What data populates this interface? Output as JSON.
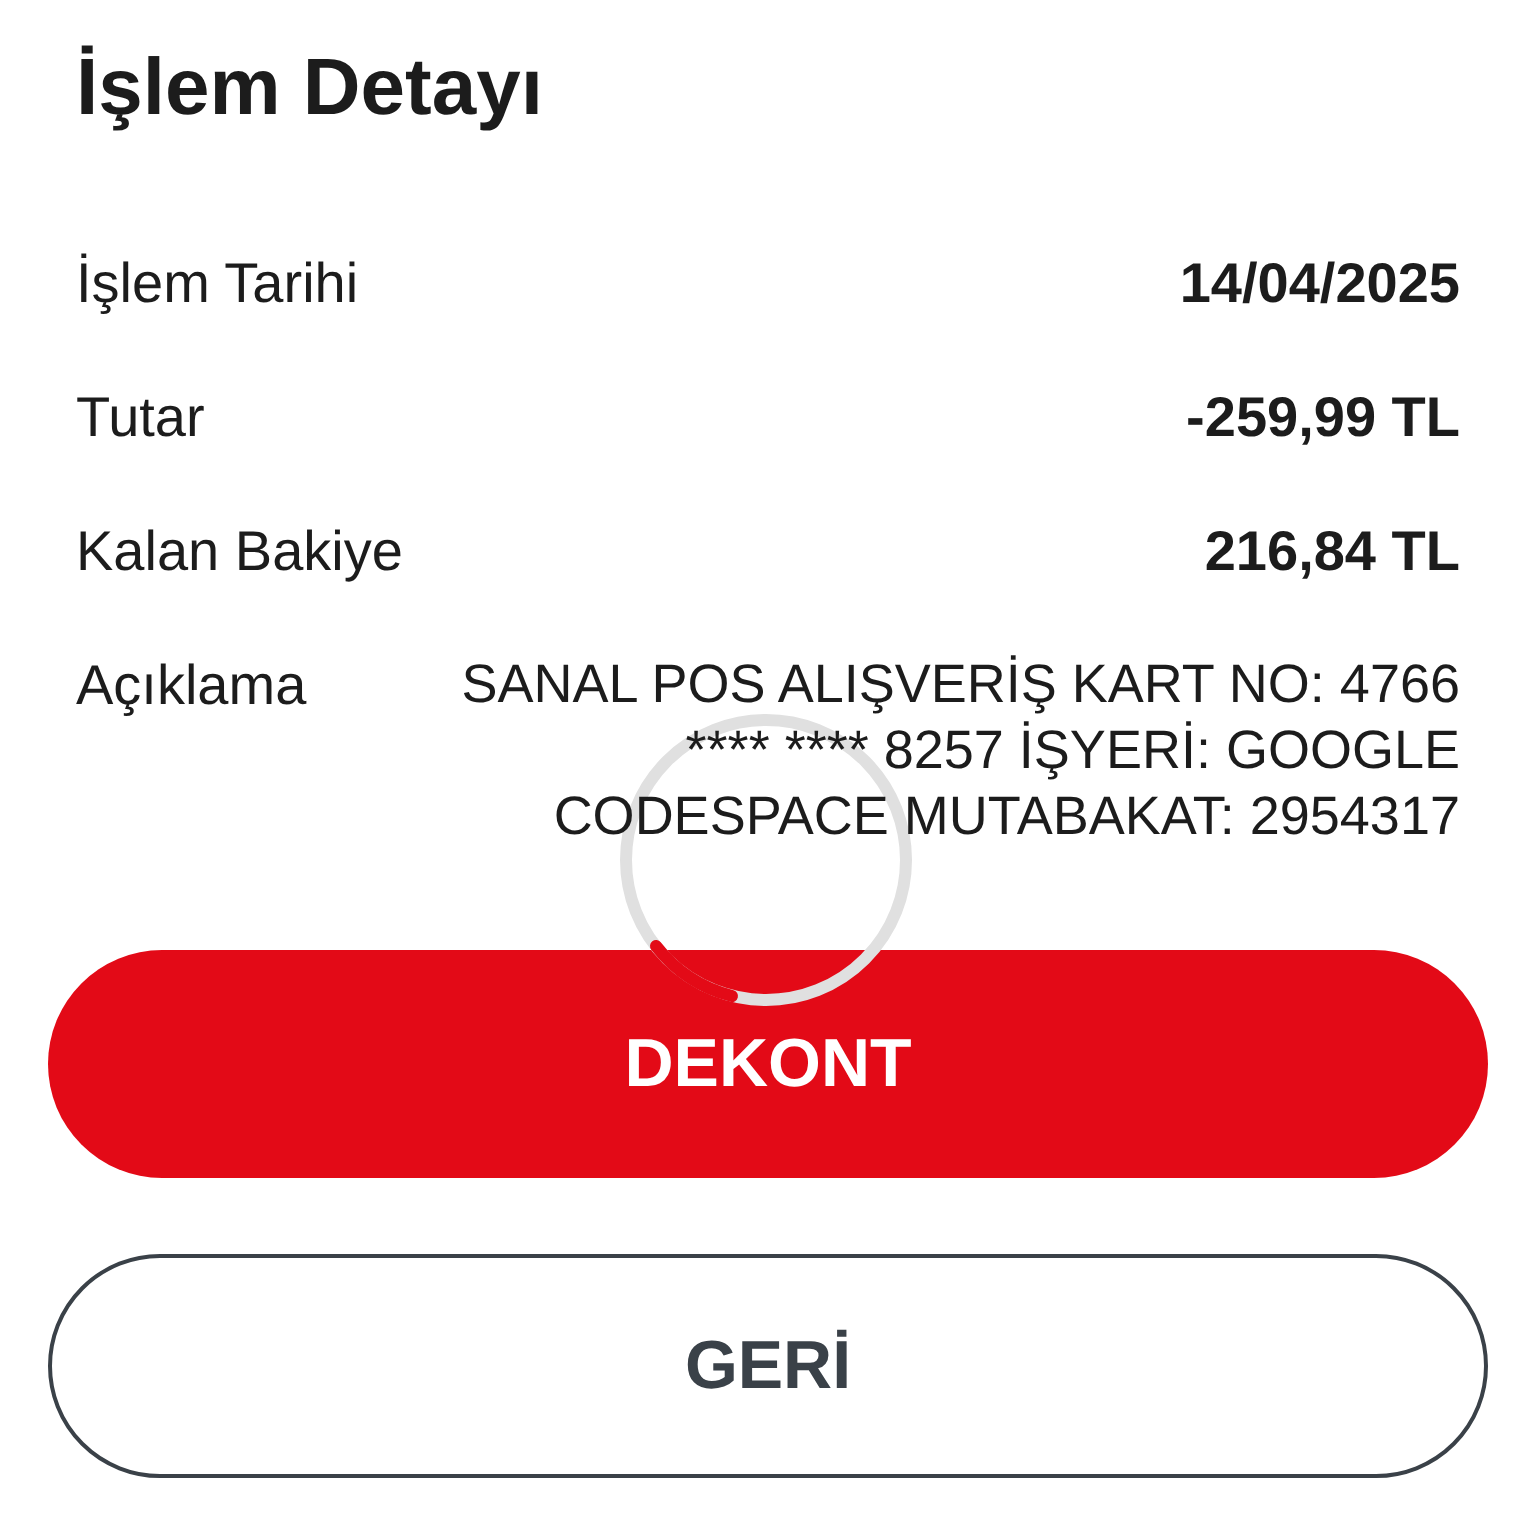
{
  "title": "İşlem Detayı",
  "details": [
    {
      "label": "İşlem Tarihi",
      "value": "14/04/2025",
      "kind": "bold"
    },
    {
      "label": "Tutar",
      "value": "-259,99 TL",
      "kind": "bold"
    },
    {
      "label": "Kalan Bakiye",
      "value": "216,84 TL",
      "kind": "bold"
    },
    {
      "label": "Açıklama",
      "value": "SANAL POS ALIŞVERİŞ KART NO: 4766 **** **** 8257 İŞYERİ: GOOGLE CODESPACE MUTABAKAT: 2954317",
      "kind": "plain"
    }
  ],
  "loading": true,
  "buttons": [
    {
      "label": "DEKONT",
      "kind": "primary"
    },
    {
      "label": "GERİ",
      "kind": "secondary"
    }
  ]
}
